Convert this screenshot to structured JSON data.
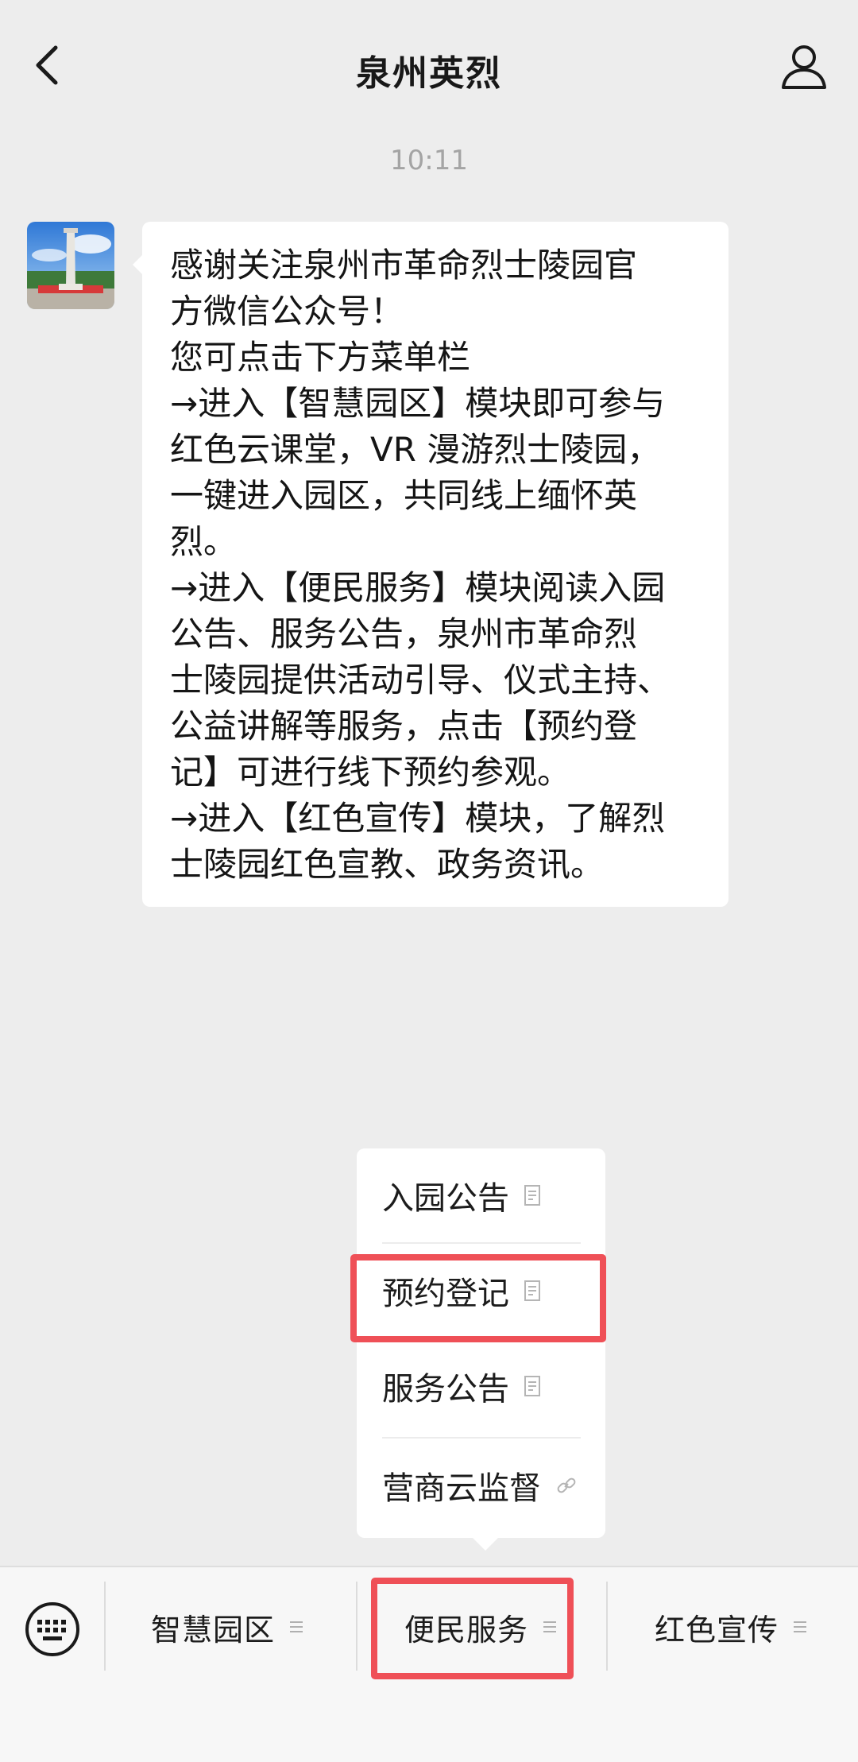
{
  "header": {
    "title": "泉州英烈",
    "back_icon": "chevron-left-icon",
    "profile_icon": "person-icon"
  },
  "chat": {
    "time": "10:11",
    "message_lines": [
      "感谢关注泉州市革命烈士陵园官",
      "方微信公众号！",
      "您可点击下方菜单栏",
      "→进入【智慧园区】模块即可参与",
      "红色云课堂，VR 漫游烈士陵园，",
      "一键进入园区，共同线上缅怀英",
      "烈。",
      "→进入【便民服务】模块阅读入园",
      "公告、服务公告，泉州市革命烈",
      "士陵园提供活动引导、仪式主持、",
      "公益讲解等服务，点击【预约登",
      "记】可进行线下预约参观。",
      "→进入【红色宣传】模块，了解烈",
      "士陵园红色宣教、政务资讯。"
    ]
  },
  "submenu": {
    "items": [
      {
        "label": "入园公告",
        "icon": "document-icon"
      },
      {
        "label": "预约登记",
        "icon": "document-icon"
      },
      {
        "label": "服务公告",
        "icon": "document-icon"
      },
      {
        "label": "营商云监督",
        "icon": "link-icon"
      }
    ]
  },
  "bottom_menu": {
    "keyboard_icon": "keyboard-icon",
    "items": [
      {
        "label": "智慧园区",
        "icon": "menu-lines-icon"
      },
      {
        "label": "便民服务",
        "icon": "menu-lines-icon"
      },
      {
        "label": "红色宣传",
        "icon": "menu-lines-icon"
      }
    ]
  },
  "colors": {
    "background": "#ededed",
    "bubble": "#ffffff",
    "highlight": "#ef5057"
  }
}
